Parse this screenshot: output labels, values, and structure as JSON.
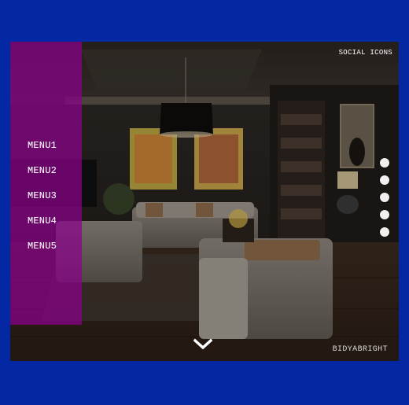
{
  "header": {
    "social_label": "SOCIAL ICONS"
  },
  "sidebar": {
    "items": [
      {
        "label": "MENU1"
      },
      {
        "label": "MENU2"
      },
      {
        "label": "MENU3"
      },
      {
        "label": "MENU4"
      },
      {
        "label": "MENU5"
      }
    ]
  },
  "footer": {
    "brand": "BIDYABRIGHT",
    "scroll_icon": "chevron-down-icon"
  },
  "pager": {
    "count": 5
  },
  "colors": {
    "page_background": "#0427a3",
    "sidebar": "#8c008c",
    "dot": "#f0f0f0",
    "text": "#ffffff"
  }
}
